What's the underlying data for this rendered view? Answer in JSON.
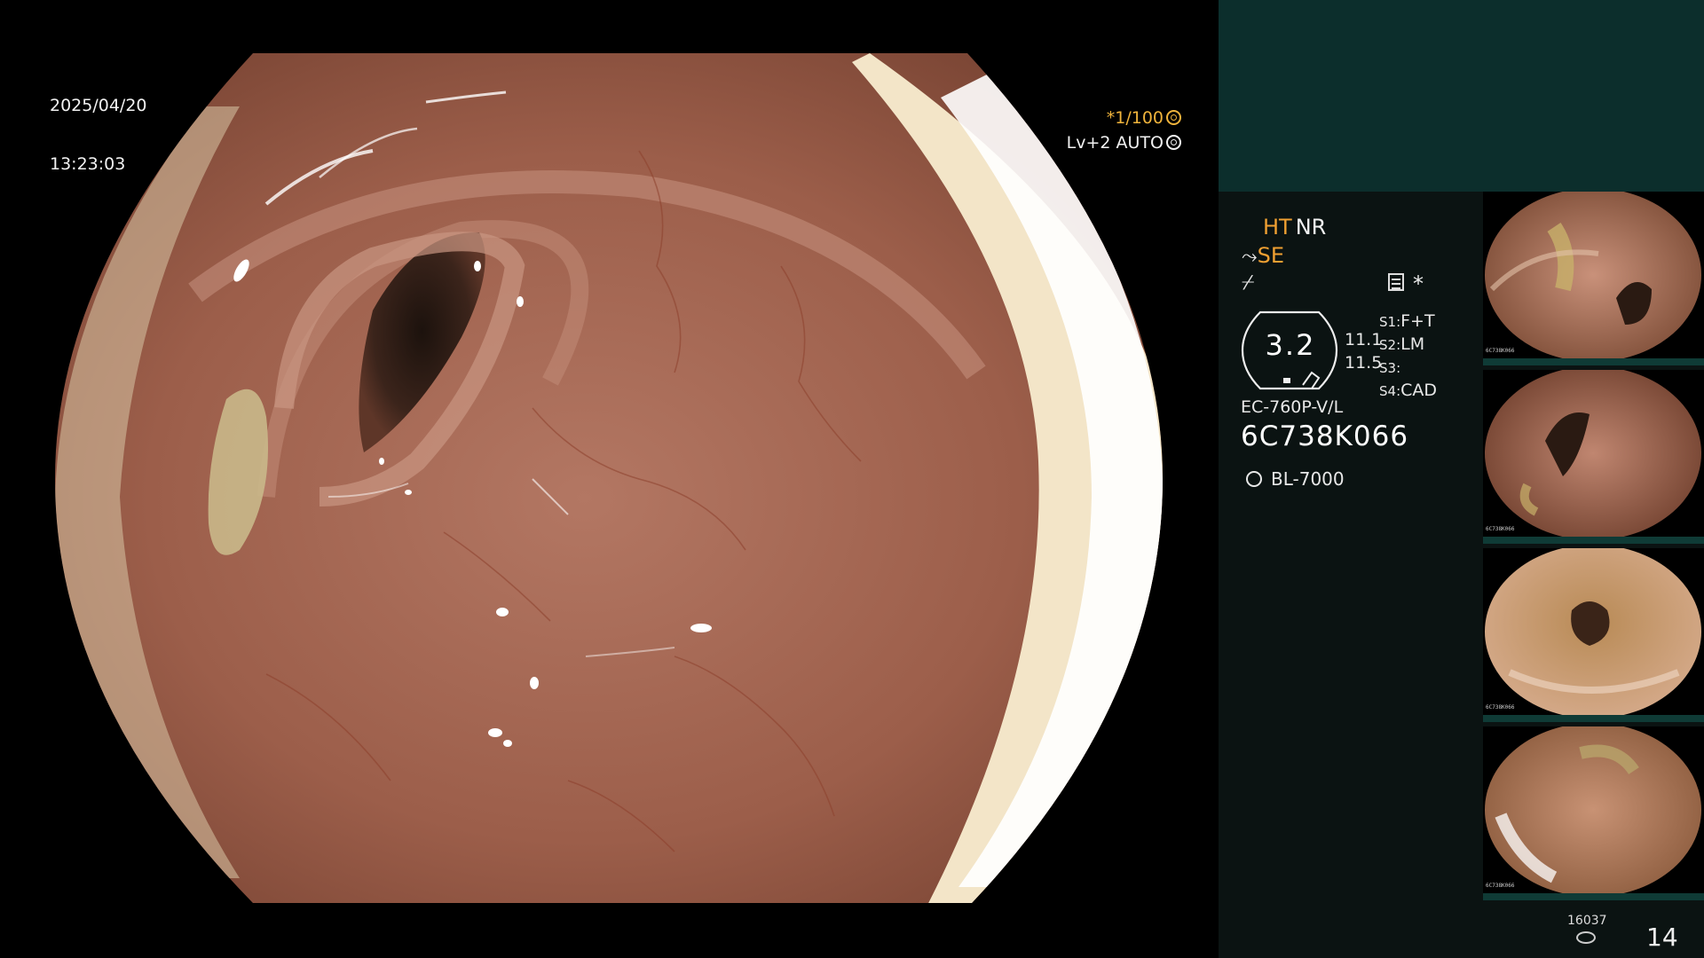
{
  "overlay": {
    "date": "2025/04/20",
    "time": "13:23:03",
    "shutter": "*1/100",
    "level": "Lv+2 AUTO",
    "shutter_icon": "aperture-icon",
    "auto_icon": "iris-icon"
  },
  "panel": {
    "ht": "HT",
    "nr": "NR",
    "se_symbol": "⤳",
    "se": "SE",
    "slash_symbol": "⌿",
    "star": "*",
    "zoom_value": "3.2",
    "value_1": "11.1",
    "value_2": "11.5",
    "s1": {
      "key": "S1:",
      "val": "F+T"
    },
    "s2": {
      "key": "S2:",
      "val": "LM"
    },
    "s3": {
      "key": "S3:",
      "val": ""
    },
    "s4": {
      "key": "S4:",
      "val": "CAD"
    },
    "scope_model": "EC-760P-V/L",
    "serial": "6C738K066",
    "light_source": "BL-7000"
  },
  "thumbnails": [
    {
      "serial": "6C738K066"
    },
    {
      "serial": "6C738K066"
    },
    {
      "serial": "6C738K066"
    },
    {
      "serial": "6C738K066"
    }
  ],
  "storage": {
    "remaining": "16037",
    "image_count": "14"
  },
  "colors": {
    "side_bg": "#0b1312",
    "side_top_bg": "#0c2e2c",
    "accent_orange": "#f0a032",
    "thumb_divider": "#0f3b36"
  }
}
